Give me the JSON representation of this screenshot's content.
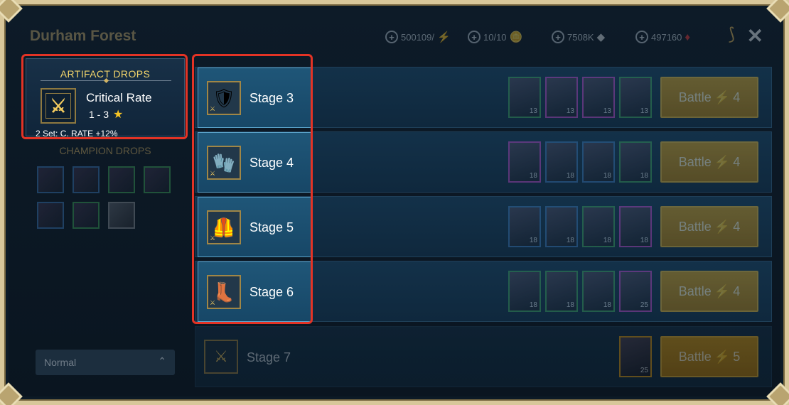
{
  "topbar": {
    "title": "Durham Forest",
    "resources": [
      {
        "value": "500109/",
        "icon": "energy-bolt-icon",
        "glyph": "⚡"
      },
      {
        "value": "10/10",
        "icon": "silver-coin-icon",
        "glyph": "🪙"
      },
      {
        "value": "7508K",
        "icon": "silver-ore-icon",
        "glyph": "◆"
      },
      {
        "value": "497160",
        "icon": "gem-icon",
        "glyph": "♦"
      }
    ],
    "plus_glyph": "+",
    "close_glyph": "✕",
    "bow_glyph": "⟆"
  },
  "artifact_drops": {
    "title": "ARTIFACT DROPS",
    "name": "Critical Rate",
    "range": "1 - 3",
    "star": "★",
    "set_bonus": "2 Set: C. RATE +12%",
    "icon": "crossed-swords-icon",
    "icon_glyph": "⚔"
  },
  "champion_drops": {
    "title": "CHAMPION DROPS"
  },
  "difficulty": {
    "selected": "Normal",
    "chevron": "⌃"
  },
  "stages": [
    {
      "label": "Stage 3",
      "icon": "shoulder-armor-icon",
      "glyph": "🛡",
      "battle_label": "Battle",
      "energy": "4"
    },
    {
      "label": "Stage 4",
      "icon": "gauntlet-icon",
      "glyph": "🧤",
      "battle_label": "Battle",
      "energy": "4"
    },
    {
      "label": "Stage 5",
      "icon": "chest-armor-icon",
      "glyph": "🦺",
      "battle_label": "Battle",
      "energy": "4"
    },
    {
      "label": "Stage 6",
      "icon": "boots-icon",
      "glyph": "👢",
      "battle_label": "Battle",
      "energy": "4"
    }
  ],
  "stage7": {
    "label": "Stage 7",
    "icon_glyph": "⚔",
    "battle_label": "Battle",
    "energy": "5",
    "enemy_level": "25"
  },
  "battle_bolt": "⚡",
  "enemy_rows": [
    [
      {
        "lv": "13"
      },
      {
        "lv": "13"
      },
      {
        "lv": "13"
      },
      {
        "lv": "13"
      }
    ],
    [
      {
        "lv": "18"
      },
      {
        "lv": "18"
      },
      {
        "lv": "18"
      },
      {
        "lv": "18"
      }
    ],
    [
      {
        "lv": "18"
      },
      {
        "lv": "18"
      },
      {
        "lv": "18"
      },
      {
        "lv": "18"
      }
    ],
    [
      {
        "lv": "18"
      },
      {
        "lv": "18"
      },
      {
        "lv": "18"
      },
      {
        "lv": "25"
      }
    ]
  ]
}
